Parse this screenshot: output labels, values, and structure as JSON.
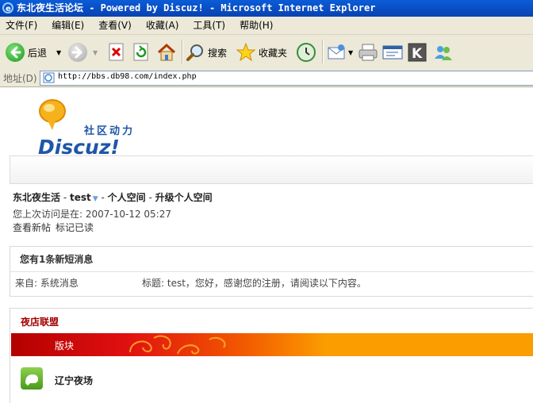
{
  "window": {
    "title": "东北夜生活论坛 - Powered by Discuz! - Microsoft Internet Explorer"
  },
  "menubar": {
    "items": [
      "文件(F)",
      "编辑(E)",
      "查看(V)",
      "收藏(A)",
      "工具(T)",
      "帮助(H)"
    ]
  },
  "toolbar": {
    "back_label": "后退",
    "search_label": "搜索",
    "favorites_label": "收藏夹"
  },
  "addressbar": {
    "label": "地址(D)",
    "url": "http://bbs.db98.com/index.php"
  },
  "logo": {
    "tagline": "社区动力",
    "wordmark": "Discuz!"
  },
  "nav": {
    "site_name": "东北夜生活",
    "user": "test",
    "space": "个人空间",
    "upgrade": "升级个人空间"
  },
  "visit": {
    "last_visit": "您上次访问是在: 2007-10-12 05:27"
  },
  "links": {
    "new_posts": "查看新帖",
    "mark_read": "标记已读"
  },
  "pm": {
    "title": "您有1条新短消息",
    "from": "来自: 系统消息",
    "subject": "标题: test，您好，感谢您的注册，请阅读以下内容。"
  },
  "category": {
    "title": "夜店联盟",
    "column_header": "版块",
    "forums": [
      {
        "name": "辽宁夜场"
      }
    ]
  }
}
